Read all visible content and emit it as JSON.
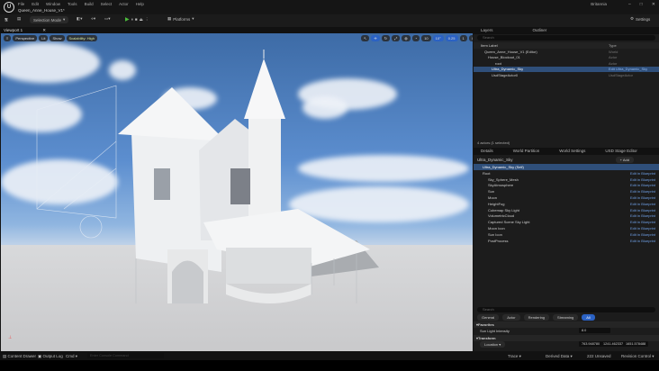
{
  "app": {
    "project": "Queen_Anne_House_V1*",
    "user": "Britannia",
    "menu": [
      "File",
      "Edit",
      "Window",
      "Tools",
      "Build",
      "Select",
      "Actor",
      "Help"
    ]
  },
  "toolbar": {
    "selection_mode": "Selection Mode",
    "platforms": "Platforms",
    "settings": "Settings"
  },
  "viewport": {
    "tab": "Viewport 1",
    "perspective": "Perspective",
    "lit": "Lit",
    "show": "Show",
    "scalability": "Scalability: High",
    "grid": "10",
    "angle": "10°",
    "scale": "0.25",
    "camera": "1"
  },
  "outliner": {
    "tabs": [
      "Layers",
      "Outliner"
    ],
    "search_placeholder": "Search",
    "col_label": "Item Label",
    "col_type": "Type",
    "items": [
      {
        "label": "Queen_Anne_House_V1 (Editor)",
        "type": "World"
      },
      {
        "label": "House_Blockout_01",
        "type": "Actor"
      },
      {
        "label": "root",
        "type": "Actor"
      },
      {
        "label": "Ultra_Dynamic_Sky",
        "type": "Edit Ultra_Dynamic_Sky"
      },
      {
        "label": "UsdStageActor0",
        "type": "UsdStageActor"
      }
    ],
    "count": "4 actors (1 selected)"
  },
  "details": {
    "tabs": [
      "Details",
      "World Partition",
      "World Settings",
      "USD Stage Editor"
    ],
    "actor": "Ultra_Dynamic_Sky",
    "add": "+ Add",
    "self": "Ultra_Dynamic_Sky (Self)",
    "edit_bp": "Edit in Blueprint",
    "components": [
      "Root",
      "Sky_Sphere_Mesh",
      "SkyAtmosphere",
      "Sun",
      "Moon",
      "HeightFog",
      "Cubemap Sky Light",
      "VolumetricCloud",
      "Captured Scene Sky Light",
      "Moon Icon",
      "Sun Icon",
      "PostProcess"
    ],
    "search_placeholder": "Search",
    "categories": [
      "General",
      "Actor",
      "Rendering",
      "Streaming",
      "All"
    ],
    "section_favorites": "Favorites",
    "sun_label": "Sun Light Intensity",
    "sun_value": "8.0",
    "section_transform": "Transform",
    "location": "Location",
    "loc": [
      "763.948780",
      "1241.462337",
      "1651.578488"
    ]
  },
  "status": {
    "content_drawer": "Content Drawer",
    "output_log": "Output Log",
    "cmd": "Cmd",
    "console_placeholder": "Enter Console Command",
    "trace": "Trace",
    "derived": "Derived Data",
    "unsaved": "222 Unsaved",
    "revision": "Revision Control"
  },
  "colors": {
    "accent": "#2b62c4",
    "selection": "#2f4f7a",
    "play": "#4cbc3c"
  }
}
